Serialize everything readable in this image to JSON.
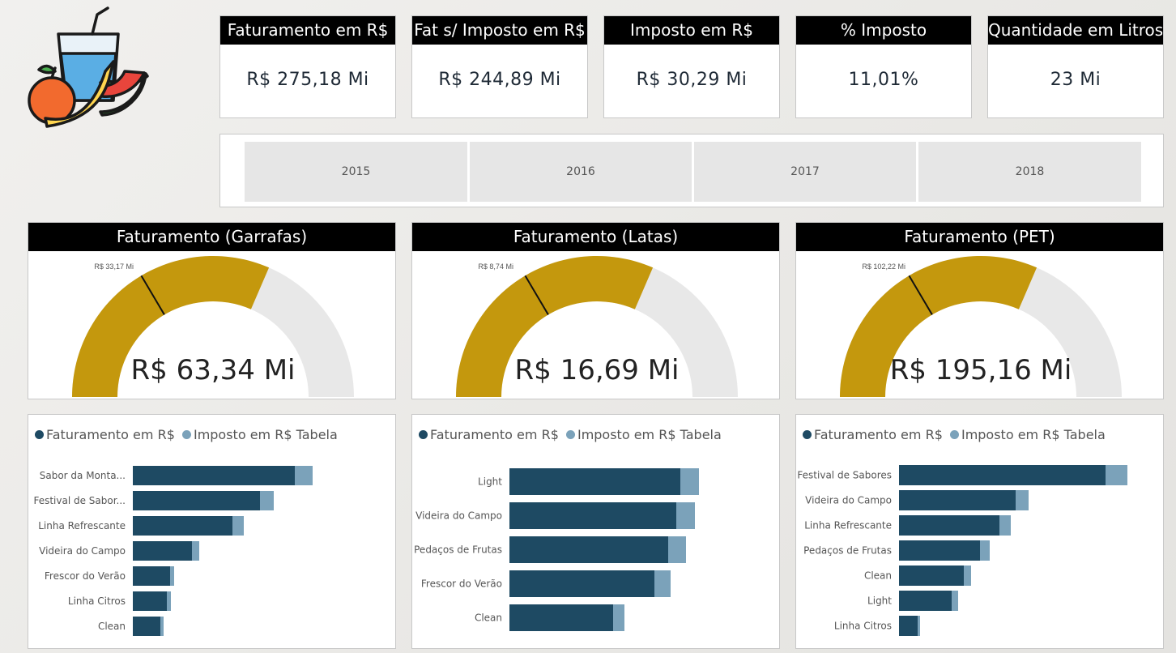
{
  "kpis": [
    {
      "title": "Faturamento em R$",
      "value": "R$ 275,18 Mi"
    },
    {
      "title": "Fat s/ Imposto em R$",
      "value": "R$ 244,89 Mi"
    },
    {
      "title": "Imposto em R$",
      "value": "R$ 30,29 Mi"
    },
    {
      "title": "% Imposto",
      "value": "11,01%"
    },
    {
      "title": "Quantidade em Litros",
      "value": "23 Mi"
    }
  ],
  "years": [
    "2015",
    "2016",
    "2017",
    "2018"
  ],
  "colors": {
    "gauge_fill": "#c4980d",
    "gauge_track": "#e8e8e8",
    "bar_main": "#1e4a63",
    "bar_tax": "#7ba2ba"
  },
  "gauges": [
    {
      "title": "Faturamento (Garrafas)",
      "value_label": "R$ 63,34 Mi",
      "target_label": "R$ 33,17 Mi",
      "fill_fraction": 0.63,
      "target_fraction": 0.33
    },
    {
      "title": "Faturamento (Latas)",
      "value_label": "R$ 16,69 Mi",
      "target_label": "R$ 8,74 Mi",
      "fill_fraction": 0.63,
      "target_fraction": 0.33
    },
    {
      "title": "Faturamento (PET)",
      "value_label": "R$ 195,16 Mi",
      "target_label": "R$ 102,22 Mi",
      "fill_fraction": 0.63,
      "target_fraction": 0.33
    }
  ],
  "legend": {
    "series1": "Faturamento em R$",
    "series2": "Imposto em R$ Tabela"
  },
  "chart_data": [
    {
      "type": "bar",
      "categories": [
        "Sabor da Monta...",
        "Festival de Sabor...",
        "Linha Refrescante",
        "Videira do Campo",
        "Frescor do Verão",
        "Linha Citros",
        "Clean"
      ],
      "series": [
        {
          "name": "Faturamento em R$",
          "values": [
            200,
            157,
            123,
            73,
            46,
            42,
            34
          ]
        },
        {
          "name": "Imposto em R$ Tabela",
          "values": [
            22,
            17,
            14,
            9,
            5,
            5,
            4
          ]
        }
      ]
    },
    {
      "type": "bar",
      "categories": [
        "Light",
        "Videira do Campo",
        "Pedaços de Frutas",
        "Frescor do Verão",
        "Clean"
      ],
      "series": [
        {
          "name": "Faturamento em R$",
          "values": [
            211,
            206,
            196,
            179,
            128
          ]
        },
        {
          "name": "Imposto em R$ Tabela",
          "values": [
            23,
            23,
            22,
            20,
            14
          ]
        }
      ]
    },
    {
      "type": "bar",
      "categories": [
        "Festival de Sabores",
        "Videira do Campo",
        "Linha Refrescante",
        "Pedaços de Frutas",
        "Clean",
        "Light",
        "Linha Citros"
      ],
      "series": [
        {
          "name": "Faturamento em R$",
          "values": [
            255,
            144,
            124,
            100,
            80,
            65,
            23
          ]
        },
        {
          "name": "Imposto em R$ Tabela",
          "values": [
            27,
            16,
            14,
            12,
            9,
            8,
            3
          ]
        }
      ]
    }
  ]
}
